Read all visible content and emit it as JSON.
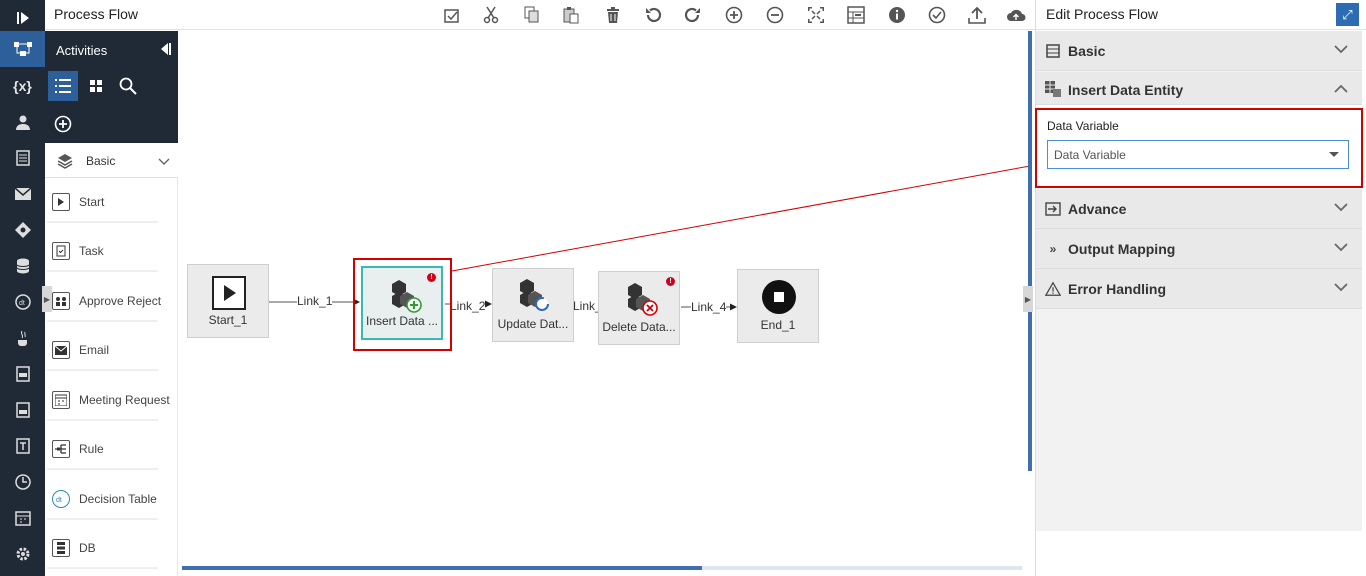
{
  "header": {
    "title": "Process Flow"
  },
  "toolbar": {
    "tools": [
      "validate-icon",
      "cut-icon",
      "copy-icon",
      "paste-icon",
      "delete-icon",
      "undo-icon",
      "redo-icon",
      "zoom-in-icon",
      "zoom-out-icon",
      "fit-icon",
      "grid-icon",
      "info-icon",
      "check-icon",
      "upload-icon",
      "cloud-icon"
    ]
  },
  "activities": {
    "title": "Activities",
    "category": "Basic",
    "items": [
      {
        "label": "Start",
        "icon": "start-icon"
      },
      {
        "label": "Task",
        "icon": "task-icon"
      },
      {
        "label": "Approve Reject",
        "icon": "approve-icon"
      },
      {
        "label": "Email",
        "icon": "email-icon"
      },
      {
        "label": "Meeting Request",
        "icon": "meeting-icon"
      },
      {
        "label": "Rule",
        "icon": "rule-icon"
      },
      {
        "label": "Decision Table",
        "icon": "decision-table-icon"
      },
      {
        "label": "DB",
        "icon": "db-icon"
      }
    ]
  },
  "flow": {
    "nodes": [
      {
        "label": "Start_1"
      },
      {
        "label": "Insert Data ..."
      },
      {
        "label": "Update Dat..."
      },
      {
        "label": "Delete Data..."
      },
      {
        "label": "End_1"
      }
    ],
    "links": [
      "Link_1",
      "Link_2",
      "Link_",
      "Link_4"
    ]
  },
  "panel": {
    "title": "Edit Process Flow",
    "sections": {
      "basic": "Basic",
      "insert": "Insert Data Entity",
      "advance": "Advance",
      "output": "Output Mapping",
      "error": "Error Handling"
    },
    "field": {
      "label": "Data Variable",
      "value": "Data Variable"
    }
  },
  "colors": {
    "rail": "#1f2a36",
    "accent": "#2d6cb4",
    "highlight": "#d40000",
    "selected_node": "#3cb8b2"
  }
}
